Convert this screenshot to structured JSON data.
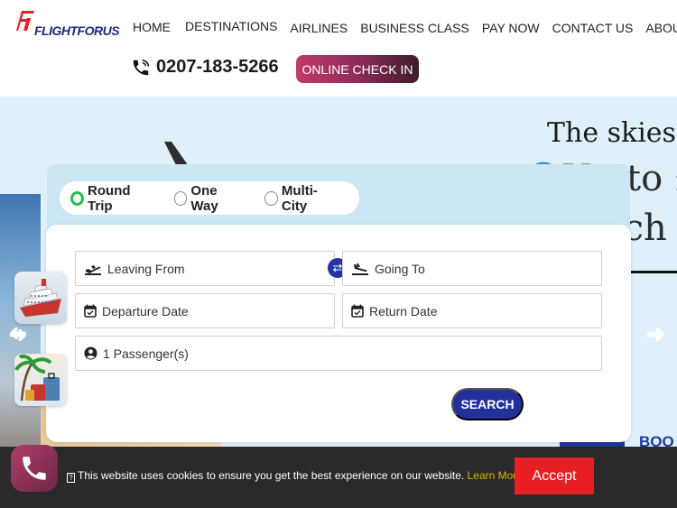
{
  "brand": {
    "logo_text": "FLIGHTFORUS",
    "accent": "#e81e25",
    "navy": "#1d2a7a"
  },
  "nav": {
    "items": [
      {
        "label": "HOME"
      },
      {
        "label": "DESTINATIONS"
      },
      {
        "label": "AIRLINES"
      },
      {
        "label": "BUSINESS CLASS"
      },
      {
        "label": "PAY NOW"
      },
      {
        "label": "CONTACT US"
      },
      {
        "label": "ABOUT US"
      }
    ]
  },
  "contact": {
    "phone": "0207-183-5266",
    "phone_icon": "phone-icon"
  },
  "checkin": {
    "label": "ONLINE CHECK IN"
  },
  "hero": {
    "title": "The skies a",
    "offer": "Up to £",
    "sub": "Reach",
    "banner": "BOO"
  },
  "trip": {
    "options": [
      {
        "label": "Round Trip",
        "checked": true
      },
      {
        "label": "One Way",
        "checked": false
      },
      {
        "label": "Multi-City",
        "checked": false
      }
    ]
  },
  "search": {
    "leaving": "Leaving From",
    "going": "Going To",
    "departure": "Departure Date",
    "return": "Return Date",
    "passengers": "1 Passenger(s)",
    "button": "SEARCH"
  },
  "cookie": {
    "text": "This website uses cookies to ensure you get the best experience on our website.",
    "learn": "Learn More...",
    "accept": "Accept"
  }
}
